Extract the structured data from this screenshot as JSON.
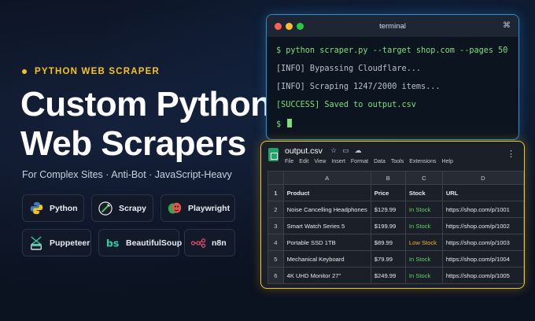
{
  "hero": {
    "tagline": "PYTHON WEB SCRAPER",
    "headline_line1": "Custom Python",
    "headline_line2": "Web Scrapers",
    "subtitle": "For Complex Sites · Anti-Bot · JavaScript-Heavy"
  },
  "tools": [
    {
      "label": "Python",
      "icon": "python-icon"
    },
    {
      "label": "Scrapy",
      "icon": "scrapy-icon"
    },
    {
      "label": "Playwright",
      "icon": "playwright-icon"
    },
    {
      "label": "Puppeteer",
      "icon": "puppeteer-icon"
    },
    {
      "label": "BeautifulSoup",
      "icon": "beautifulsoup-icon"
    },
    {
      "label": "n8n",
      "icon": "n8n-icon"
    }
  ],
  "terminal": {
    "title": "terminal",
    "shortcut": "⌘",
    "lines": [
      "$ python scraper.py --target shop.com --pages 50",
      "[INFO] Bypassing Cloudflare...",
      "[INFO] Scraping 1247/2000 items...",
      "[SUCCESS] Saved to output.csv",
      "$"
    ]
  },
  "sheet": {
    "filename": "output.csv",
    "menu": [
      "File",
      "Edit",
      "View",
      "Insert",
      "Format",
      "Data",
      "Tools",
      "Extensions",
      "Help"
    ],
    "columns": [
      "A",
      "B",
      "C",
      "D"
    ],
    "header_row": {
      "num": "1",
      "cells": [
        "Product",
        "Price",
        "Stock",
        "URL"
      ]
    },
    "rows": [
      {
        "num": "2",
        "product": "Noise Cancelling Headphones",
        "price": "$129.99",
        "stock": "In Stock",
        "url": "https://shop.com/p/1001"
      },
      {
        "num": "3",
        "product": "Smart Watch Series 5",
        "price": "$199.99",
        "stock": "In Stock",
        "url": "https://shop.com/p/1002"
      },
      {
        "num": "4",
        "product": "Portable SSD 1TB",
        "price": "$89.99",
        "stock": "Low Stock",
        "url": "https://shop.com/p/1003"
      },
      {
        "num": "5",
        "product": "Mechanical Keyboard",
        "price": "$79.99",
        "stock": "In Stock",
        "url": "https://shop.com/p/1004"
      },
      {
        "num": "6",
        "product": "4K UHD Monitor 27\"",
        "price": "$249.99",
        "stock": "In Stock",
        "url": "https://shop.com/p/1005"
      }
    ]
  },
  "colors": {
    "accent": "#f5c518",
    "terminal_border": "#2a8fd6",
    "in_stock": "#5fd36a",
    "low_stock": "#f0b429"
  }
}
